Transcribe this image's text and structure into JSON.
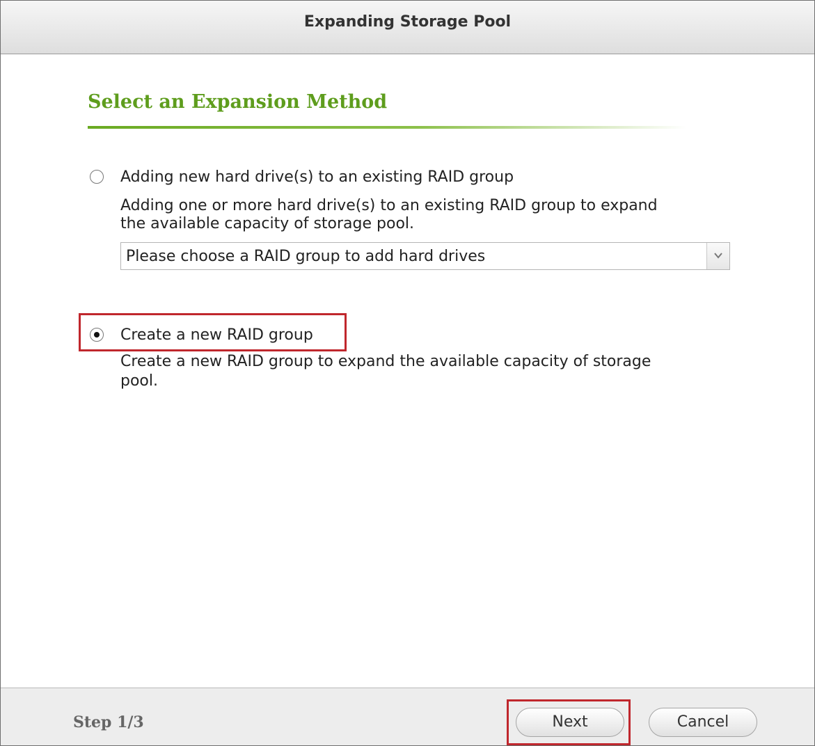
{
  "dialog": {
    "title": "Expanding Storage Pool"
  },
  "section": {
    "title": "Select an Expansion Method"
  },
  "options": [
    {
      "label": "Adding new hard drive(s) to an existing RAID group",
      "description_line1": "Adding one or more hard drive(s) to an existing RAID group to expand",
      "description_line2": "the available capacity of storage pool.",
      "selected": false
    },
    {
      "label": "Create a new RAID group",
      "description_line1": "Create a new RAID group to expand the available capacity of storage",
      "description_line2": "pool.",
      "selected": true
    }
  ],
  "raid_select": {
    "value": "Please choose a RAID group to add hard drives",
    "icon": "chevron-down-icon"
  },
  "footer": {
    "step": "Step 1/3",
    "next_label": "Next",
    "cancel_label": "Cancel"
  },
  "colors": {
    "accent_green": "#5e9d1d",
    "highlight_red": "#c0272d"
  }
}
